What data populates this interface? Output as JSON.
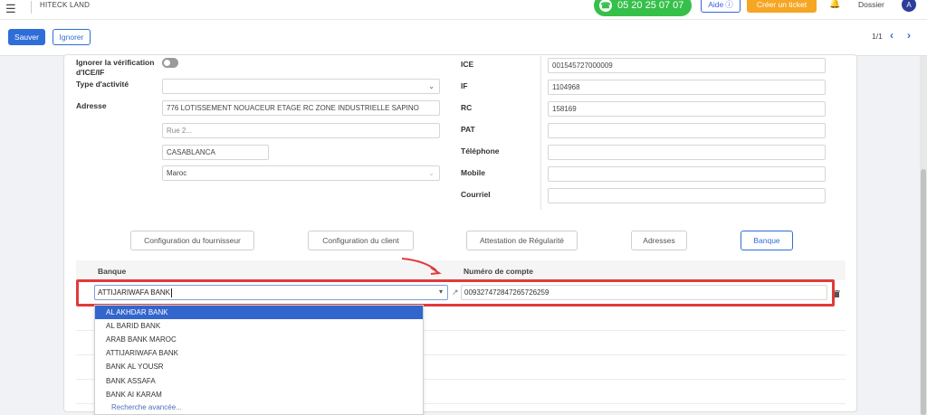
{
  "header": {
    "company": "HITECK LAND",
    "phone": "05 20 25 07 07",
    "help_label": "Aide",
    "ticket_label": "Créer un ticket",
    "dossier_label": "Dossier",
    "avatar_initial": "A"
  },
  "toolbar": {
    "save_label": "Sauver",
    "ignore_label": "Ignorer",
    "pager": "1/1"
  },
  "form": {
    "ignore_label": "Ignorer la vérification d'ICE/IF",
    "activity_label": "Type d'activité",
    "address_label": "Adresse",
    "address_line1": "776 LOTISSEMENT NOUACEUR ETAGE RC ZONE INDUSTRIELLE SAPINO",
    "address_line2_placeholder": "Rue 2...",
    "city": "CASABLANCA",
    "country": "Maroc",
    "ice_label": "ICE",
    "ice_value": "001545727000009",
    "if_label": "IF",
    "if_value": "1104968",
    "rc_label": "RC",
    "rc_value": "158169",
    "pat_label": "PAT",
    "phone_label": "Téléphone",
    "mobile_label": "Mobile",
    "email_label": "Courriel"
  },
  "tabs": [
    {
      "label": "Configuration du fournisseur"
    },
    {
      "label": "Configuration du client"
    },
    {
      "label": "Attestation de Régularité"
    },
    {
      "label": "Adresses"
    },
    {
      "label": "Banque"
    }
  ],
  "bank_table": {
    "col_bank": "Banque",
    "col_account": "Numéro de compte",
    "row": {
      "bank": "ATTIJARIWAFA BANK",
      "account": "009327472847265726259"
    }
  },
  "dropdown": {
    "options": [
      "AL AKHDAR BANK",
      "AL BARID BANK",
      "ARAB BANK MAROC",
      "ATTIJARIWAFA BANK",
      "BANK AL YOUSR",
      "BANK ASSAFA",
      "BANK AI KARAM"
    ],
    "selected_index": 0,
    "advanced_search": "Recherche avancée..."
  },
  "colors": {
    "primary": "#2f6ed8",
    "phone_green": "#35c04a",
    "ticket_orange": "#f5a623",
    "annotation_red": "#e23a3a",
    "dropdown_selected": "#3366cc"
  }
}
